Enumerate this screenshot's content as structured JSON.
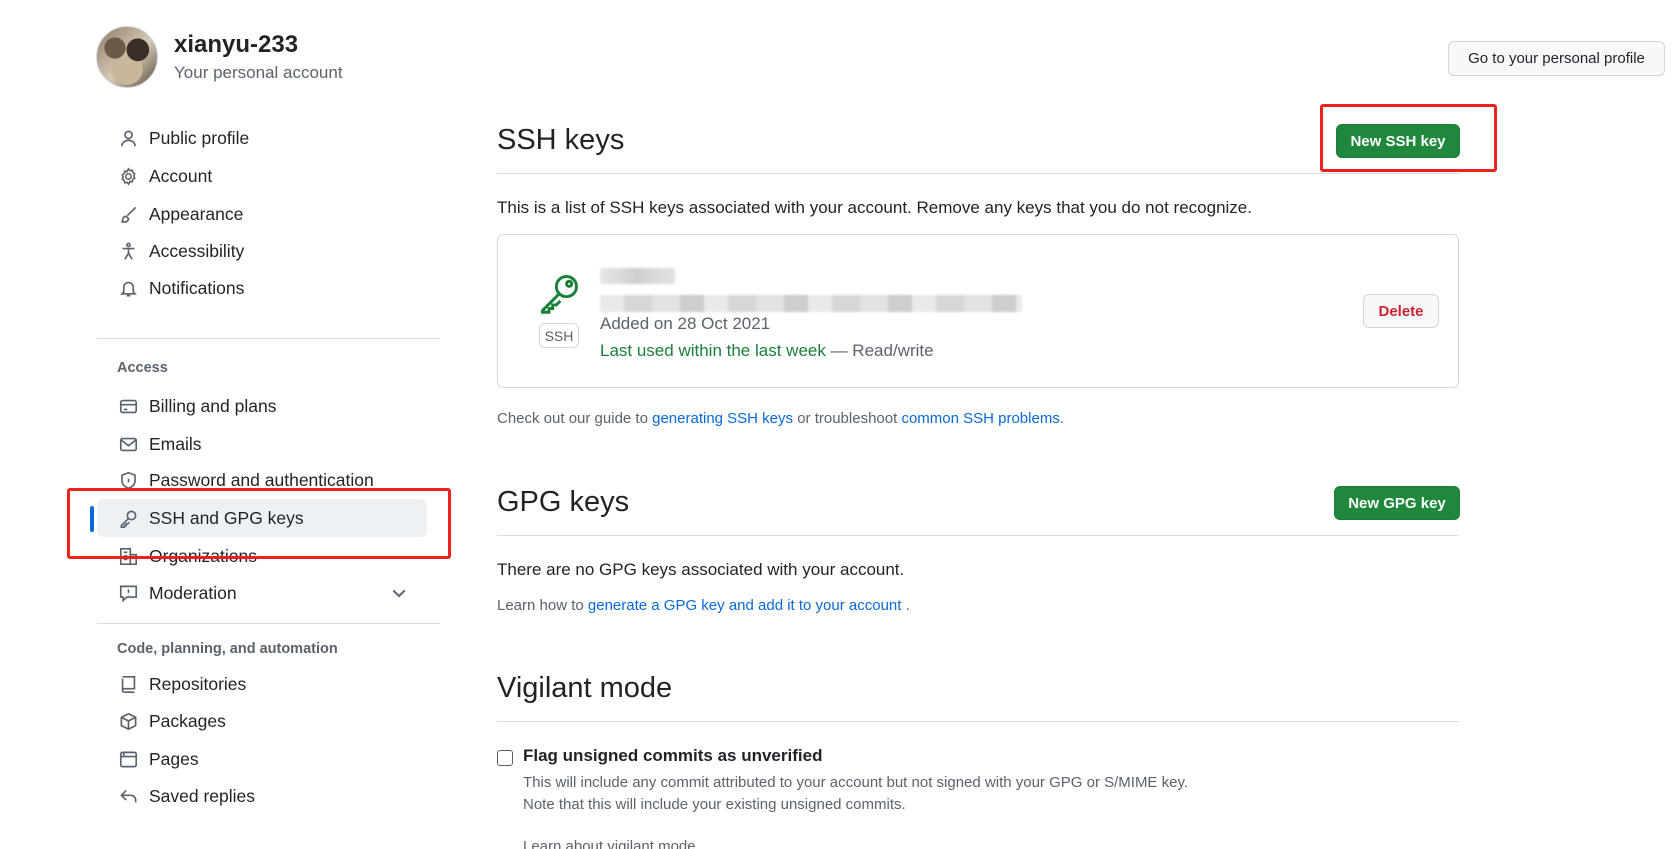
{
  "header": {
    "username": "xianyu-233",
    "subtitle": "Your personal account",
    "profile_button": "Go to your personal profile"
  },
  "sidebar": {
    "group1": [
      {
        "label": "Public profile",
        "icon": "person-icon"
      },
      {
        "label": "Account",
        "icon": "gear-icon"
      },
      {
        "label": "Appearance",
        "icon": "paintbrush-icon"
      },
      {
        "label": "Accessibility",
        "icon": "accessibility-icon"
      },
      {
        "label": "Notifications",
        "icon": "bell-icon"
      }
    ],
    "access_heading": "Access",
    "group2": [
      {
        "label": "Billing and plans",
        "icon": "credit-card-icon"
      },
      {
        "label": "Emails",
        "icon": "mail-icon"
      },
      {
        "label": "Password and authentication",
        "icon": "shield-lock-icon"
      },
      {
        "label": "SSH and GPG keys",
        "icon": "key-icon",
        "active": true
      },
      {
        "label": "Organizations",
        "icon": "organization-icon"
      },
      {
        "label": "Moderation",
        "icon": "report-icon"
      }
    ],
    "code_heading": "Code, planning, and automation",
    "group3": [
      {
        "label": "Repositories",
        "icon": "repo-icon"
      },
      {
        "label": "Packages",
        "icon": "package-icon"
      },
      {
        "label": "Pages",
        "icon": "browser-icon"
      },
      {
        "label": "Saved replies",
        "icon": "reply-icon"
      }
    ]
  },
  "ssh": {
    "title": "SSH keys",
    "new_button": "New SSH key",
    "description": "This is a list of SSH keys associated with your account. Remove any keys that you do not recognize.",
    "key": {
      "badge": "SSH",
      "added": "Added on 28 Oct 2021",
      "last_used": "Last used within the last week",
      "access": " — Read/write",
      "delete_button": "Delete"
    },
    "guide_prefix": "Check out our guide to ",
    "guide_link1": "generating SSH keys",
    "guide_middle": " or troubleshoot ",
    "guide_link2": "common SSH problems",
    "guide_suffix": "."
  },
  "gpg": {
    "title": "GPG keys",
    "new_button": "New GPG key",
    "empty": "There are no GPG keys associated with your account.",
    "learn_prefix": "Learn how to ",
    "learn_link": "generate a GPG key and add it to your account",
    "learn_suffix": " ."
  },
  "vigilant": {
    "title": "Vigilant mode",
    "checkbox_label": "Flag unsigned commits as unverified",
    "note1": "This will include any commit attributed to your account but not signed with your GPG or S/MIME key.",
    "note2": "Note that this will include your existing unsigned commits.",
    "learn_link": "Learn about vigilant mode"
  },
  "colors": {
    "accent": "#0969da",
    "primary_button": "#1f883d",
    "danger": "#cf222e",
    "annotation": "#e8221f"
  }
}
